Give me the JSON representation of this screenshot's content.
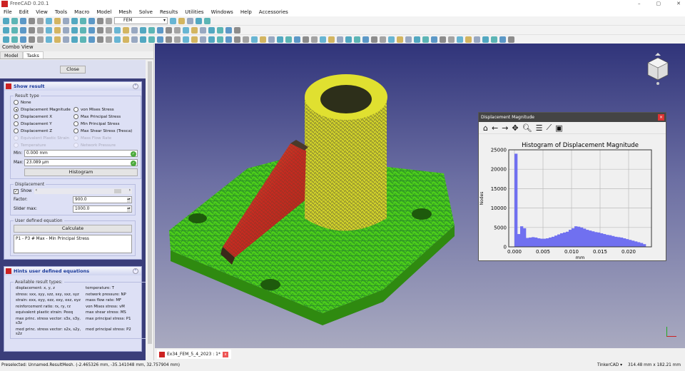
{
  "app": {
    "title": "FreeCAD 0.20.1",
    "logo_text": "Fc"
  },
  "menu": [
    "File",
    "Edit",
    "View",
    "Tools",
    "Macro",
    "Model",
    "Mesh",
    "Solve",
    "Results",
    "Utilities",
    "Windows",
    "Help",
    "Accessories"
  ],
  "toolbar": {
    "workbench": "FEM"
  },
  "combo": {
    "title": "Combo View",
    "tabs": [
      "Model",
      "Tasks"
    ]
  },
  "task": {
    "close_label": "Close",
    "show_result": {
      "title": "Show result",
      "result_type_label": "Result type",
      "options_left": [
        "None",
        "Displacement Magnitude",
        "Displacement X",
        "Displacement Y",
        "Displacement Z",
        "Equivalent Plastic Strain",
        "Temperature"
      ],
      "options_right": [
        "von Mises Stress",
        "Max Principal Stress",
        "Min Principal Stress",
        "Max Shear Stress (Tresca)",
        "Mass Flow Rate",
        "Network Pressure"
      ],
      "selected": "Displacement Magnitude",
      "min_label": "Min:",
      "min_value": "0.000 mm",
      "max_label": "Max:",
      "max_value": "23.089 µm",
      "histogram_label": "Histogram",
      "displacement_label": "Displacement",
      "show_label": "Show",
      "show_checked": true,
      "factor_label": "Factor:",
      "factor_value": "900.0",
      "slider_max_label": "Slider max:",
      "slider_max_value": "1000.0",
      "slider_fraction": 0.9,
      "user_eq_label": "User defined equation",
      "calculate_label": "Calculate",
      "equation": "P1 - P3 # Max - Min Principal Stress"
    },
    "hints": {
      "title": "Hints user defined equations",
      "available_label": "Available result types:",
      "left": [
        "displacement: x, y, z",
        "stress: sxx, syy, szz, sxy, sxz, syz",
        "strain: exx, eyy, ezz, exy, exz, eyz",
        "reinforcement ratio: rx, ry, rz",
        "equivalent plastic strain: Peeq",
        "max princ. stress vector: s3x, s3y, s3z",
        "med princ. stress vector: s2x, s2y, s2z"
      ],
      "right": [
        "temperature: T",
        "network pressure: NP",
        "mass flow rate: MF",
        "von Mises stress: vM",
        "max shear stress: MS",
        "max principal stress: P1",
        "med principal stress: P2"
      ]
    }
  },
  "doc_tab": "Ex34_FEM_5_4_2023 : 1*",
  "status": {
    "preselected": "Preselected: Unnamed.ResultMesh. (-2.465326 mm, -35.141048 mm, 32.757904 mm)",
    "nav_style": "TinkerCAD",
    "dimensions": "314.48 mm x 182.21 mm"
  },
  "histogram_window": {
    "title": "Displacement Magnitude"
  },
  "chart_data": {
    "type": "bar",
    "title": "Histogram of Displacement Magnitude",
    "xlabel": "mm",
    "ylabel": "Nodes",
    "xlim": [
      -0.001,
      0.024
    ],
    "ylim": [
      0,
      25000
    ],
    "xticks": [
      "0.000",
      "0.005",
      "0.010",
      "0.015",
      "0.020"
    ],
    "xtick_values": [
      0,
      0.005,
      0.01,
      0.015,
      0.02
    ],
    "yticks": [
      "0",
      "5000",
      "10000",
      "15000",
      "20000",
      "25000"
    ],
    "ytick_values": [
      0,
      5000,
      10000,
      15000,
      20000,
      25000
    ],
    "bin_width": 0.0005,
    "bin_start": 0,
    "values": [
      24000,
      3300,
      5300,
      4800,
      2300,
      2400,
      2500,
      2400,
      2200,
      2100,
      2100,
      2200,
      2400,
      2600,
      2900,
      3200,
      3500,
      3700,
      3900,
      4400,
      4800,
      5300,
      5200,
      5000,
      4700,
      4400,
      4200,
      4000,
      3800,
      3700,
      3500,
      3300,
      3100,
      3000,
      2800,
      2600,
      2500,
      2400,
      2200,
      2000,
      1800,
      1600,
      1400,
      1200,
      1000,
      700
    ],
    "color": "#7070f0",
    "grid": true
  },
  "colors": {
    "accent": "#1b3a9a",
    "panel_bg": "#dde0f5",
    "viewport_top": "#30347a"
  }
}
